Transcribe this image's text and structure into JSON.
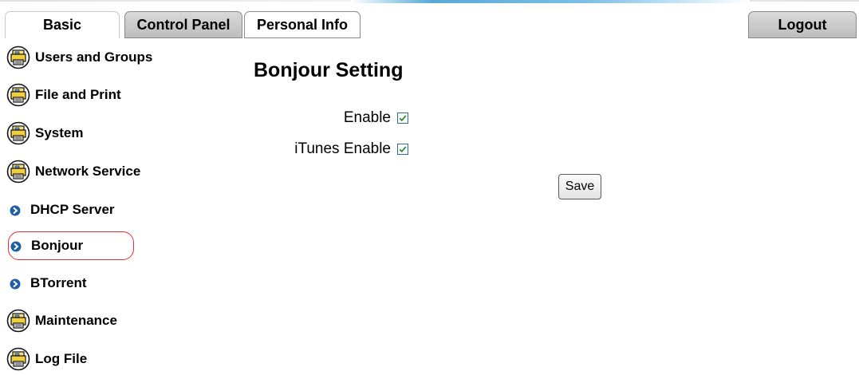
{
  "tabs": {
    "basic": "Basic",
    "control_panel": "Control Panel",
    "personal_info": "Personal Info",
    "logout": "Logout"
  },
  "sidebar": {
    "items": [
      {
        "label": "Users and Groups",
        "icon": "printer-folder-icon",
        "type": "section"
      },
      {
        "label": "File and Print",
        "icon": "printer-folder-icon",
        "type": "section"
      },
      {
        "label": "System",
        "icon": "printer-folder-icon",
        "type": "section"
      },
      {
        "label": "Network Service",
        "icon": "printer-folder-icon",
        "type": "section"
      },
      {
        "label": "DHCP Server",
        "icon": "blue-arrow-bullet-icon",
        "type": "sub"
      },
      {
        "label": "Bonjour",
        "icon": "blue-arrow-bullet-icon",
        "type": "sub",
        "selected": true
      },
      {
        "label": "BTorrent",
        "icon": "blue-arrow-bullet-icon",
        "type": "sub"
      },
      {
        "label": "Maintenance",
        "icon": "printer-folder-icon",
        "type": "section"
      },
      {
        "label": "Log File",
        "icon": "printer-folder-icon",
        "type": "section"
      }
    ]
  },
  "main": {
    "title": "Bonjour Setting",
    "fields": [
      {
        "label": "Enable",
        "checked": true
      },
      {
        "label": "iTunes Enable",
        "checked": true
      }
    ],
    "save_label": "Save"
  },
  "colors": {
    "selection_outline": "#e03030",
    "bullet_blue": "#1f5fa8",
    "checkmark_green": "#2e8b2e",
    "tab_grey": "#c8c8c8"
  }
}
